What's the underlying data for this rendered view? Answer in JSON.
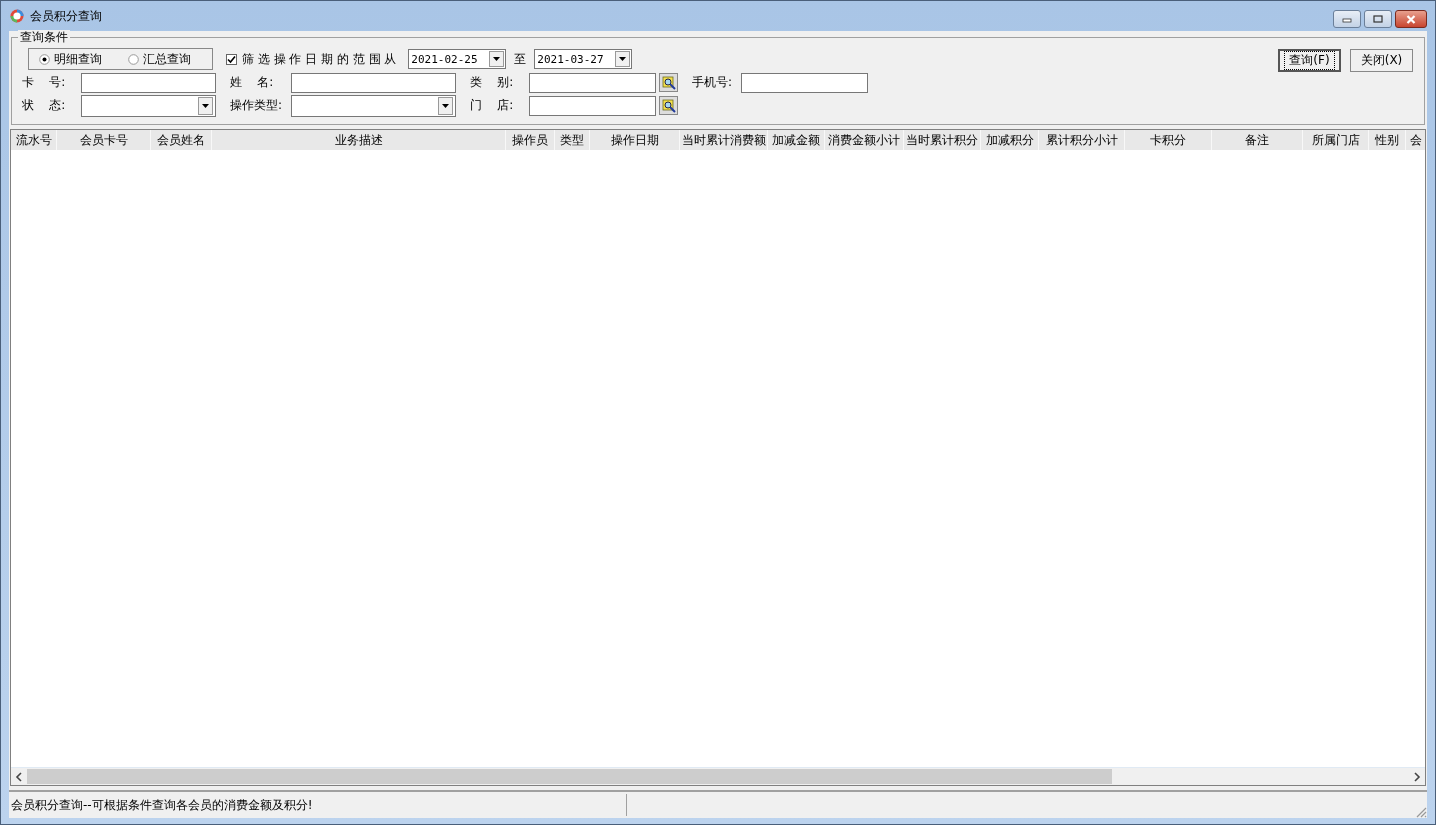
{
  "window": {
    "title": "会员积分查询"
  },
  "criteria": {
    "title": "查询条件",
    "mode_radios": [
      {
        "label": "明细查询",
        "selected": true
      },
      {
        "label": "汇总查询",
        "selected": false
      }
    ],
    "date_filter": {
      "label": "筛 选 操 作 日 期 的 范 围 从",
      "checked": true,
      "from": "2021-02-25",
      "to_label": "至",
      "to": "2021-03-27"
    },
    "field_rows": [
      [
        {
          "label": "卡    号:",
          "kind": "text"
        },
        {
          "label": "姓    名:",
          "kind": "text"
        },
        {
          "label": "类    别:",
          "kind": "lookup"
        },
        {
          "label": "手机号:",
          "kind": "text"
        }
      ],
      [
        {
          "label": "状    态:",
          "kind": "select"
        },
        {
          "label": "操作类型:",
          "kind": "select"
        },
        {
          "label": "门    店:",
          "kind": "lookup"
        }
      ]
    ],
    "buttons": [
      {
        "label": "查询(F)",
        "focused": true
      },
      {
        "label": "关闭(X)",
        "focused": false
      }
    ]
  },
  "table": {
    "columns": [
      "流水号",
      "会员卡号",
      "会员姓名",
      "业务描述",
      "操作员",
      "类型",
      "操作日期",
      "当时累计消费额",
      "加减金额",
      "消费金额小计",
      "当时累计积分",
      "加减积分",
      "累计积分小计",
      "卡积分",
      "备注",
      "所属门店",
      "性别",
      "会"
    ]
  },
  "status_bar": {
    "message": "会员积分查询--可根据条件查询各会员的消费金额及积分!"
  }
}
